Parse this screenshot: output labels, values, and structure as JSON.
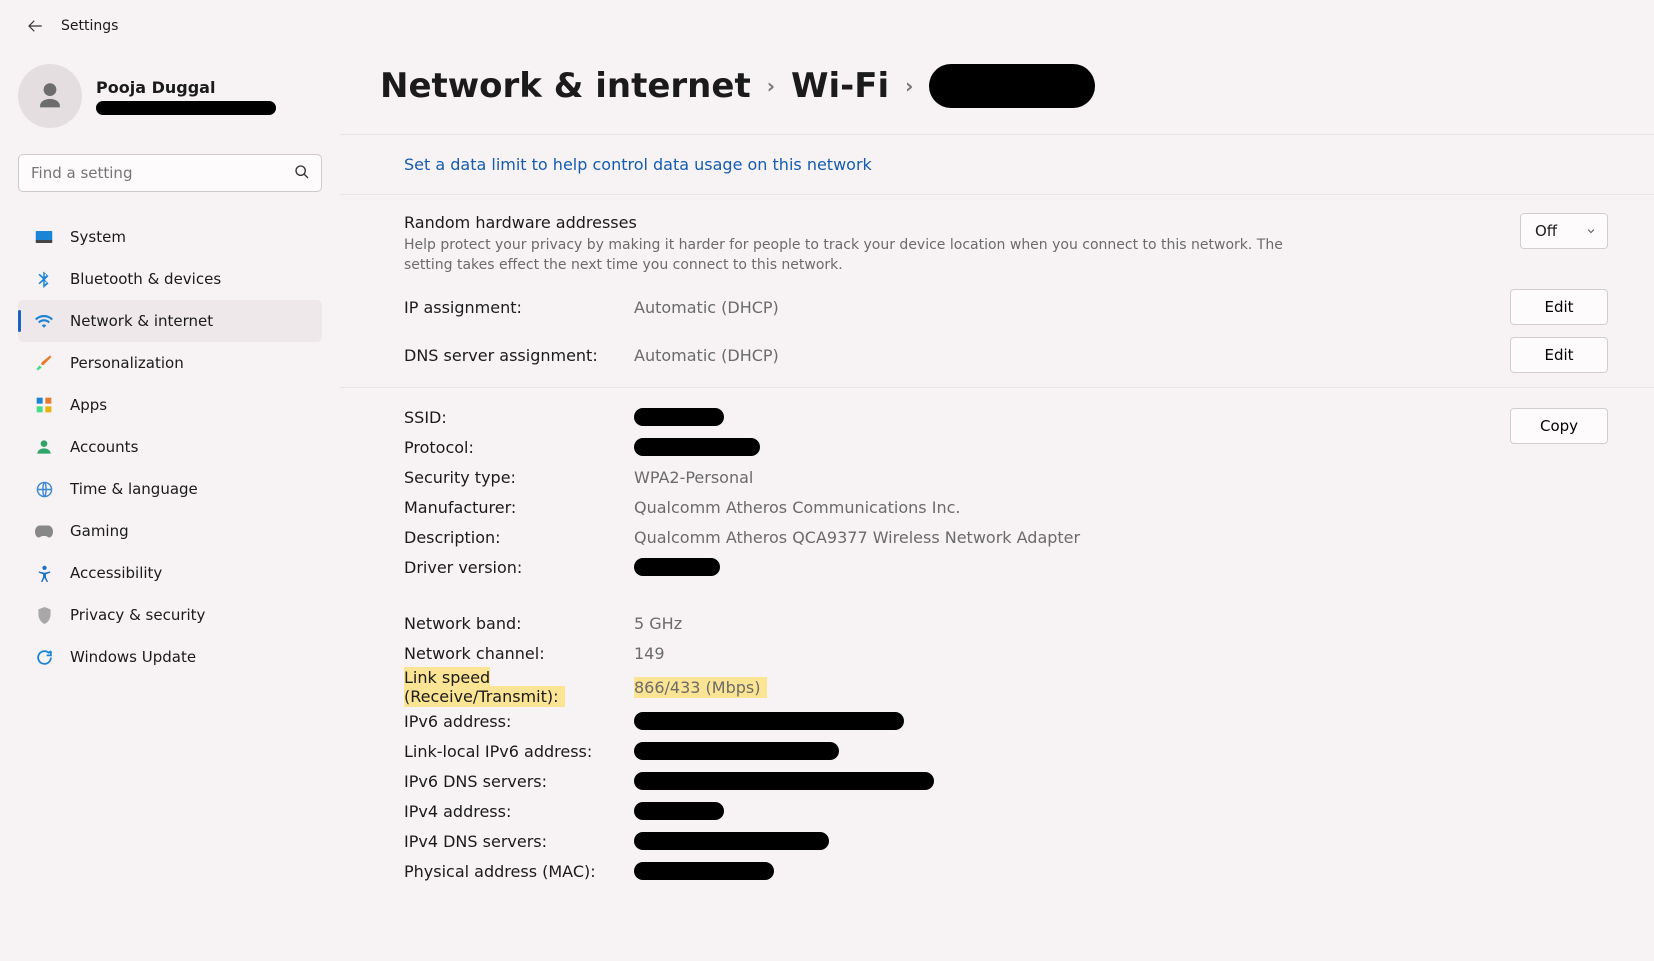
{
  "app_title": "Settings",
  "profile": {
    "name": "Pooja Duggal"
  },
  "search": {
    "placeholder": "Find a setting"
  },
  "nav": [
    {
      "id": "system",
      "label": "System",
      "icon": "💻"
    },
    {
      "id": "bluetooth",
      "label": "Bluetooth & devices",
      "icon": "bt"
    },
    {
      "id": "network",
      "label": "Network & internet",
      "icon": "wifi",
      "active": true
    },
    {
      "id": "personalization",
      "label": "Personalization",
      "icon": "🖌️"
    },
    {
      "id": "apps",
      "label": "Apps",
      "icon": "apps"
    },
    {
      "id": "accounts",
      "label": "Accounts",
      "icon": "👤"
    },
    {
      "id": "time",
      "label": "Time & language",
      "icon": "🌐"
    },
    {
      "id": "gaming",
      "label": "Gaming",
      "icon": "🎮"
    },
    {
      "id": "accessibility",
      "label": "Accessibility",
      "icon": "acc"
    },
    {
      "id": "privacy",
      "label": "Privacy & security",
      "icon": "🛡️"
    },
    {
      "id": "update",
      "label": "Windows Update",
      "icon": "update"
    }
  ],
  "breadcrumb": {
    "parent": "Network & internet",
    "mid": "Wi-Fi"
  },
  "data_limit_link": "Set a data limit to help control data usage on this network",
  "random_hw": {
    "heading": "Random hardware addresses",
    "desc": "Help protect your privacy by making it harder for people to track your device location when you connect to this network. The setting takes effect the next time you connect to this network.",
    "toggle_value": "Off"
  },
  "ip_assignment": {
    "label": "IP assignment:",
    "value": "Automatic (DHCP)",
    "btn": "Edit"
  },
  "dns_assignment": {
    "label": "DNS server assignment:",
    "value": "Automatic (DHCP)",
    "btn": "Edit"
  },
  "copy_btn": "Copy",
  "details": {
    "ssid_label": "SSID:",
    "protocol_label": "Protocol:",
    "security_label": "Security type:",
    "security_val": "WPA2-Personal",
    "manufacturer_label": "Manufacturer:",
    "manufacturer_val": "Qualcomm Atheros Communications Inc.",
    "description_label": "Description:",
    "description_val": "Qualcomm Atheros QCA9377 Wireless Network Adapter",
    "driver_label": "Driver version:",
    "band_label": "Network band:",
    "band_val": "5 GHz",
    "channel_label": "Network channel:",
    "channel_val": "149",
    "link_label": "Link speed (Receive/Transmit):",
    "link_val": "866/433 (Mbps)",
    "ipv6_label": "IPv6 address:",
    "linklocal_label": "Link-local IPv6 address:",
    "ipv6dns_label": "IPv6 DNS servers:",
    "ipv4_label": "IPv4 address:",
    "ipv4dns_label": "IPv4 DNS servers:",
    "mac_label": "Physical address (MAC):"
  }
}
